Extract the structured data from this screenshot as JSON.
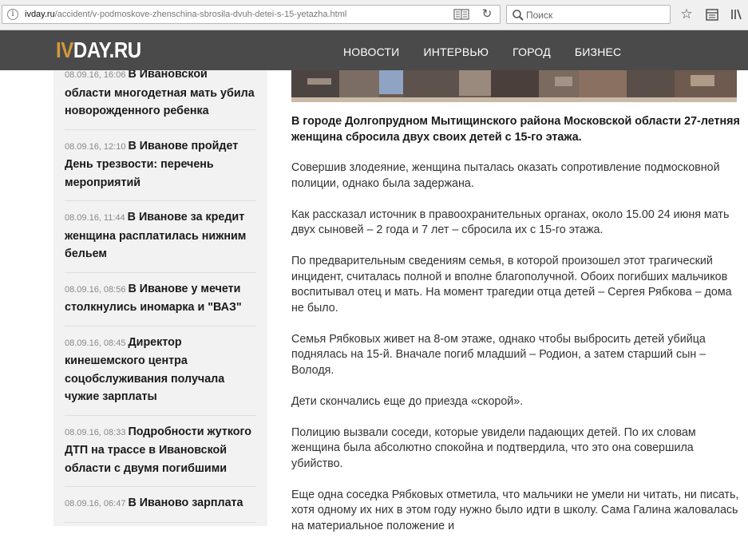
{
  "browser": {
    "url_host": "ivday.ru",
    "url_path": "/accident/v-podmoskove-zhenschina-sbrosila-dvuh-detei-s-15-yetazha.html",
    "search_placeholder": "Поиск",
    "info_icon": "info-icon",
    "reader_icon": "reader-view-icon",
    "reload_icon": "reload-icon",
    "bookmark_icon": "star-icon",
    "library_icon": "library-icon"
  },
  "site": {
    "logo_prefix": "IV",
    "logo_rest": "DAY.RU",
    "brand_color": "#d29a3b",
    "header_bg": "#4a4a4a",
    "nav": [
      {
        "label": "НОВОСТИ"
      },
      {
        "label": "ИНТЕРВЬЮ"
      },
      {
        "label": "ГОРОД"
      },
      {
        "label": "БИЗНЕС"
      }
    ]
  },
  "sidebar": {
    "items": [
      {
        "time": "08.09.16, 16:06",
        "title": "В Ивановской области многодетная мать убила новорожденного ребенка"
      },
      {
        "time": "08.09.16, 12:10",
        "title": "В Иванове пройдет День трезвости: перечень мероприятий"
      },
      {
        "time": "08.09.16, 11:44",
        "title": "В Иванове за кредит женщина расплатилась нижним бельем"
      },
      {
        "time": "08.09.16, 08:56",
        "title": "В Иванове у мечети столкнулись иномарка и \"ВАЗ\""
      },
      {
        "time": "08.09.16, 08:45",
        "title": "Директор кинешемского центра соцобслуживания получала чужие зарплаты"
      },
      {
        "time": "08.09.16, 08:33",
        "title": "Подробности жуткого ДТП на трассе в Ивановской области с двумя погибшими"
      },
      {
        "time": "08.09.16, 06:47",
        "title": "В Иваново зарплата"
      }
    ]
  },
  "article": {
    "lead": "В городе Долгопрудном Мытищинского района Московской области 27-летняя женщина сбросила двух своих детей с 15-го этажа.",
    "paragraphs": [
      "Совершив злодеяние, женщина пыталась оказать сопротивление подмосковной полиции, однако была задержана.",
      "Как рассказал источник в правоохранительных органах, около 15.00 24 июня мать двух сыновей – 2 года и 7 лет – сбросила их с 15-го этажа.",
      "По предварительным сведениям семья, в которой произошел этот трагический инцидент, считалась полной и вполне благополучной. Обоих погибших мальчиков воспитывал отец и мать. На момент трагедии отца детей – Сергея Рябкова – дома не было.",
      "Семья Рябковых живет на 8-ом этаже, однако чтобы выбросить детей убийца поднялась на 15-й. Вначале погиб младший – Родион, а затем старший сын – Володя.",
      "Дети скончались еще до приезда «скорой».",
      "Полицию вызвали соседи, которые увидели падающих детей. По их словам женщина была абсолютно спокойна и подтвердила, что это она совершила убийство.",
      "Еще одна соседка Рябковых отметила, что мальчики не умели ни читать, ни писать, хотя одному их них в этом году нужно было идти в школу. Сама Галина жаловалась на материальное положение и"
    ]
  }
}
